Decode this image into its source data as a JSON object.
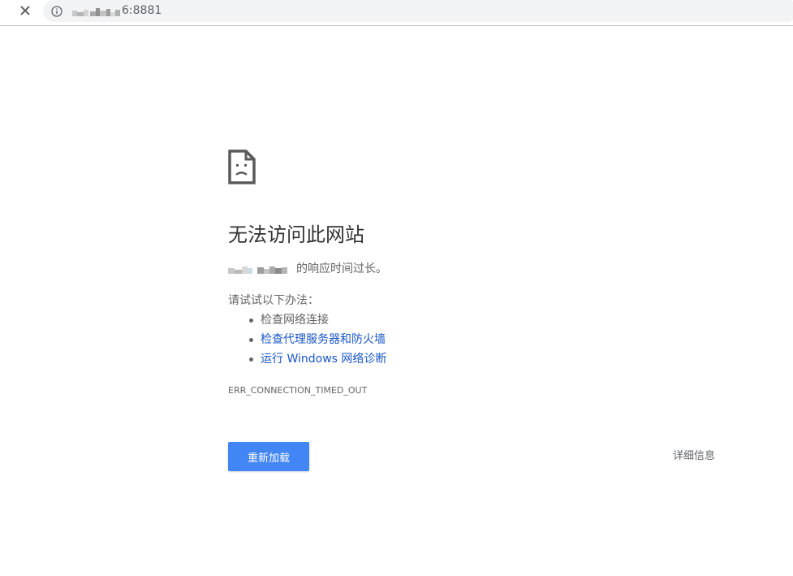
{
  "toolbar": {
    "forward_icon": "arrow-forward-icon",
    "stop_icon": "close-icon",
    "info_icon": "info-icon",
    "url_visible": "6:8881"
  },
  "error": {
    "icon": "sad-document-icon",
    "title": "无法访问此网站",
    "host_suffix": "的响应时间过长。",
    "try_intro": "请试试以下办法：",
    "suggestions": [
      {
        "label": "检查网络连接",
        "is_link": false
      },
      {
        "label": "检查代理服务器和防火墙",
        "is_link": true
      },
      {
        "label": "运行 Windows 网络诊断",
        "is_link": true
      }
    ],
    "code": "ERR_CONNECTION_TIMED_OUT",
    "reload_label": "重新加载",
    "details_label": "详细信息"
  },
  "colors": {
    "accent": "#4285f4",
    "link": "#1a55c5",
    "text": "#646464",
    "title": "#333333"
  }
}
